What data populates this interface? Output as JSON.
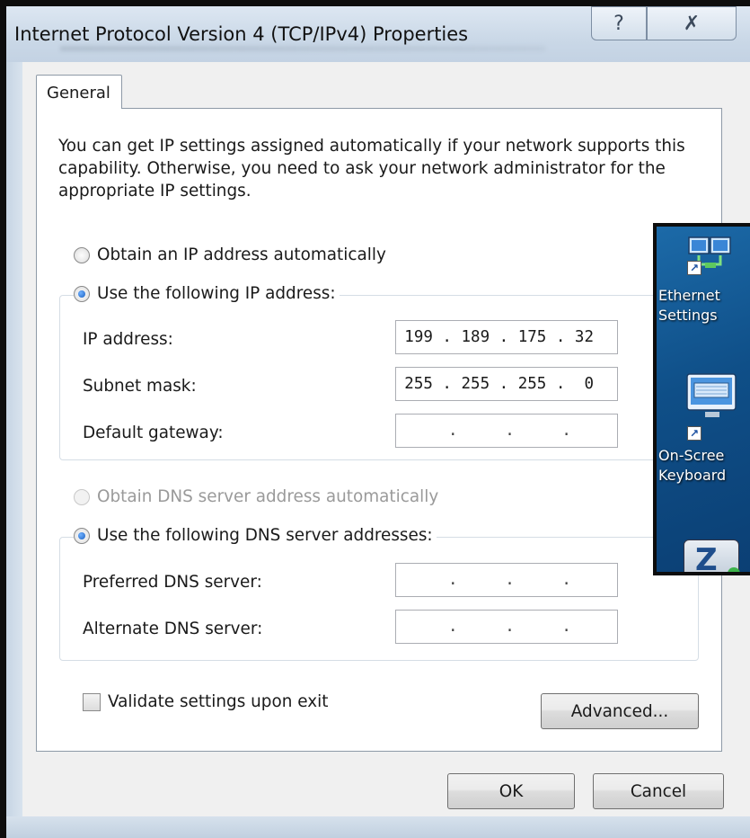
{
  "window": {
    "title": "Internet Protocol Version 4 (TCP/IPv4) Properties",
    "help_glyph": "?",
    "close_glyph": "✗"
  },
  "tabs": [
    {
      "label": "General",
      "selected": true
    }
  ],
  "description": "You can get IP settings assigned automatically if your network supports this capability. Otherwise, you need to ask your network administrator for the appropriate IP settings.",
  "ip_section": {
    "auto_label": "Obtain an IP address automatically",
    "manual_label": "Use the following IP address:",
    "selected": "manual",
    "fields": [
      {
        "label": "IP address:",
        "value": "199 . 189 . 175 . 32"
      },
      {
        "label": "Subnet mask:",
        "value": "255 . 255 . 255 .  0"
      },
      {
        "label": "Default gateway:",
        "value": ".     .     ."
      }
    ]
  },
  "dns_section": {
    "auto_label": "Obtain DNS server address automatically",
    "auto_disabled": true,
    "manual_label": "Use the following DNS server addresses:",
    "selected": "manual",
    "fields": [
      {
        "label": "Preferred DNS server:",
        "value": ".     .     ."
      },
      {
        "label": "Alternate DNS server:",
        "value": ".     .     ."
      }
    ]
  },
  "validate_label": "Validate settings upon exit",
  "validate_checked": false,
  "buttons": {
    "advanced": "Advanced...",
    "ok": "OK",
    "cancel": "Cancel"
  },
  "desktop": {
    "icons": [
      {
        "name": "ethernet-settings",
        "line1": "Ethernet",
        "line2": "Settings"
      },
      {
        "name": "on-screen-keyboard",
        "line1": "On-Scree",
        "line2": "Keyboard"
      },
      {
        "name": "app-z",
        "glyph": "Z"
      }
    ]
  },
  "colors": {
    "radio_selected": "#1a5fc0",
    "desktop_bg": "#0f4f88"
  }
}
